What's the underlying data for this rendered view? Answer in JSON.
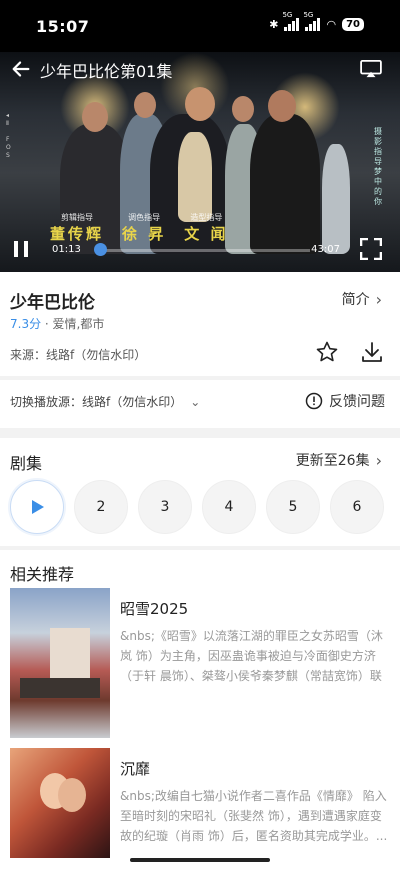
{
  "status_bar": {
    "time": "15:07",
    "battery": "70",
    "net1": "5G",
    "net2": "5G"
  },
  "player": {
    "title": "少年巴比伦第01集",
    "current_time": "01:13",
    "total_time": "43:07",
    "progress": 0.028,
    "credits": [
      {
        "role": "剪辑指导",
        "name": "董传辉"
      },
      {
        "role": "调色指导",
        "name": "徐 昇"
      },
      {
        "role": "造型指导",
        "name": "文 闻"
      }
    ],
    "side_text": "摄影指导 梦中的你"
  },
  "info": {
    "title": "少年巴比伦",
    "brief_label": "简介",
    "score": "7.3分",
    "genres": "· 爱情,都市",
    "source": "来源：线路f（勿信水印）"
  },
  "switch_source": {
    "label": "切换播放源：线路f（勿信水印）"
  },
  "feedback": {
    "label": "反馈问题"
  },
  "episodes": {
    "title": "剧集",
    "update_label": "更新至26集",
    "items": [
      "2",
      "3",
      "4",
      "5",
      "6"
    ]
  },
  "recommend": {
    "title": "相关推荐",
    "items": [
      {
        "name": "昭雪2025",
        "desc": "&nbs;《昭雪》以流落江湖的罪臣之女苏昭雪（沐岚 饰）为主角，因巫蛊诡事被迫与冷面御史方济（于轩 晨饰）、桀骜小侯爷秦梦麒（常喆宽饰）联手破..."
      },
      {
        "name": "沉靡",
        "desc": "&nbs;改编自七猫小说作者二喜作品《情靡》 陷入至暗时刻的宋昭礼（张斐然 饰），遇到遭遇家庭变故的纪璇（肖雨 饰）后，匿名资助其完成学业。..."
      }
    ]
  },
  "colors": {
    "accent": "#3a8ee6",
    "credit_yellow": "#e8d44a"
  }
}
